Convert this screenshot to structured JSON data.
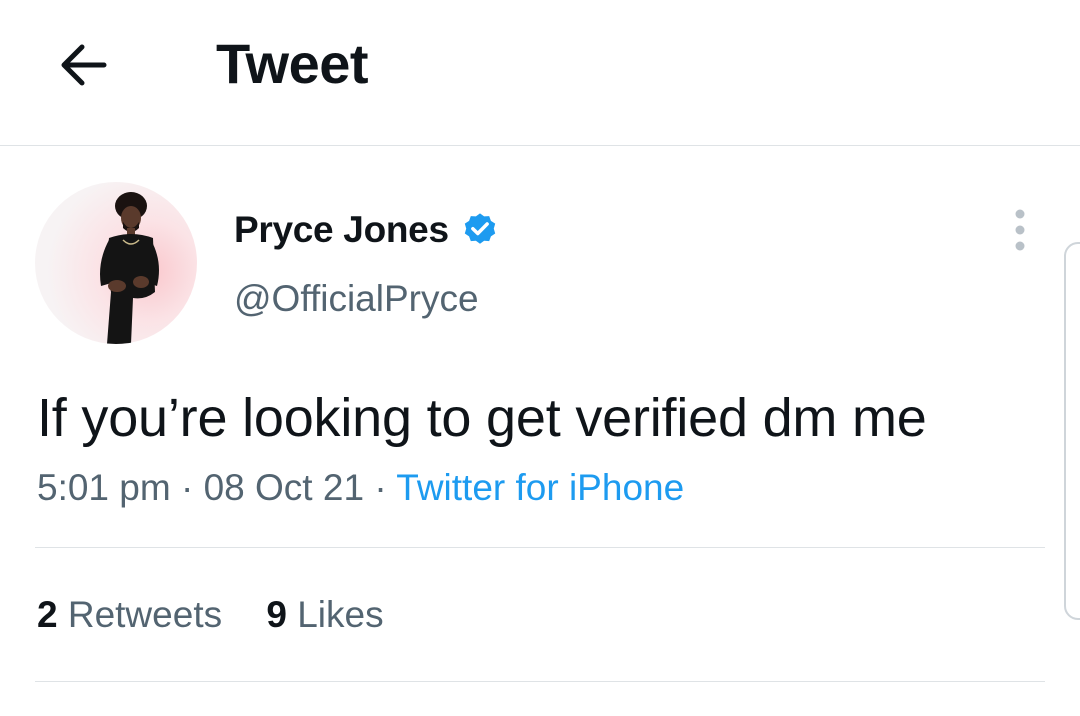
{
  "header": {
    "title": "Tweet",
    "back_icon": "arrow-left-icon"
  },
  "tweet": {
    "author": {
      "display_name": "Pryce Jones",
      "handle": "@OfficialPryce",
      "verified": true,
      "verified_color": "#1d9bf0"
    },
    "text": "If you’re looking to get verified dm me",
    "time": "5:01 pm",
    "date": "08 Oct 21",
    "separator": "·",
    "source": "Twitter for iPhone",
    "retweets": {
      "count": "2",
      "label": "Retweets"
    },
    "likes": {
      "count": "9",
      "label": "Likes"
    }
  },
  "colors": {
    "text_primary": "#0f1419",
    "text_secondary": "#536471",
    "accent": "#1d9bf0",
    "divider": "#dfe3e6"
  }
}
